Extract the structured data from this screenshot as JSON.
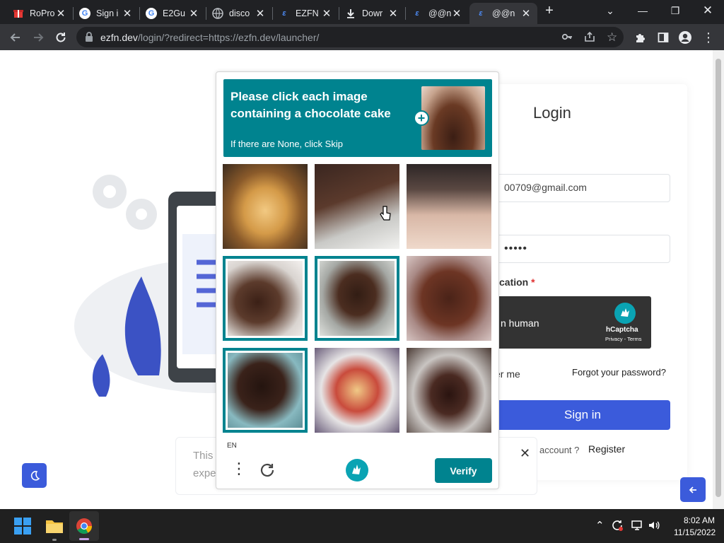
{
  "browser": {
    "tabs": [
      {
        "title": "RoPro",
        "favicon": "gift-icon"
      },
      {
        "title": "Sign i",
        "favicon": "google-icon"
      },
      {
        "title": "E2Gu",
        "favicon": "google-icon"
      },
      {
        "title": "disco",
        "favicon": "globe-icon"
      },
      {
        "title": "EZFN",
        "favicon": "ezfn-icon"
      },
      {
        "title": "Dowr",
        "favicon": "download-icon"
      },
      {
        "title": "@@n",
        "favicon": "ezfn-icon"
      },
      {
        "title": "@@n",
        "favicon": "ezfn-icon",
        "active": true
      }
    ],
    "url_domain": "ezfn.dev",
    "url_path": "/login/?redirect=https://ezfn.dev/launcher/"
  },
  "login": {
    "title": "Login",
    "email_value": "00709@gmail.com",
    "password_value": "•••••",
    "verification_label": "cation",
    "required_mark": "*",
    "human_label": "n human",
    "hcaptcha_brand": "hCaptcha",
    "hcaptcha_links": "Privacy - Terms",
    "remember_label": "er me",
    "forgot_link": "Forgot your password?",
    "signin_button": "Sign in",
    "no_account_text": "account ?",
    "register_link": "Register"
  },
  "toast": {
    "line1": "This",
    "line2": "expe"
  },
  "captcha": {
    "prompt": "Please click each image containing a chocolate cake",
    "sub": "If there are None, click Skip",
    "language": "EN",
    "verify_button": "Verify",
    "tiles": [
      {
        "content": "pancakes with syrup",
        "selected": false
      },
      {
        "content": "chocolate layer cake slice",
        "selected": false
      },
      {
        "content": "birthday cake with candles",
        "selected": false
      },
      {
        "content": "chocolate cake slice",
        "selected": true
      },
      {
        "content": "chocolate layer cake slice",
        "selected": true
      },
      {
        "content": "whole chocolate cake",
        "selected": false
      },
      {
        "content": "chocolate cake slice",
        "selected": true
      },
      {
        "content": "pancakes with berries",
        "selected": false
      },
      {
        "content": "chocolate dome dessert",
        "selected": false
      }
    ]
  },
  "taskbar": {
    "time": "8:02 AM",
    "date": "11/15/2022"
  },
  "colors": {
    "captcha_teal": "#00838f",
    "signin_blue": "#3b5bdb",
    "chrome_dark": "#202124"
  }
}
